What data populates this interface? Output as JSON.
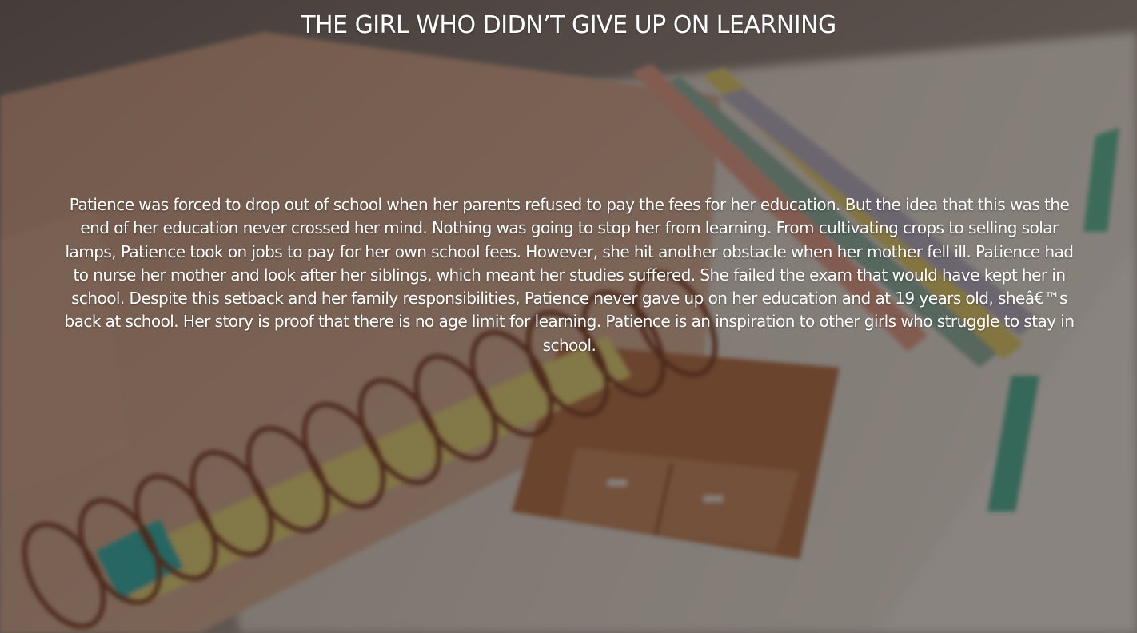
{
  "slide": {
    "title": "THE GIRL WHO DIDN’T GIVE UP ON LEARNING",
    "body": "Patience was forced to drop out of school when her parents refused to pay the fees for her education. But the idea that this was the end of her education never crossed her mind. Nothing was going to stop her from learning. From cultivating crops to selling solar lamps, Patience took on jobs to pay for her own school fees. However, she hit another obstacle when her mother fell ill. Patience had to nurse her mother and look after her siblings, which meant her studies suffered. She failed the exam that would have kept her in school. Despite this setback and her family responsibilities, Patience never gave up on her education and at 19 years old, sheâ€™s back at school. Her story is proof that there is no age limit for learning. Patience is an inspiration to other girls who struggle to stay in school."
  },
  "background": {
    "scene": "notebook-with-spiral-and-pencils-photo",
    "overlay_color": "#1e1816"
  }
}
